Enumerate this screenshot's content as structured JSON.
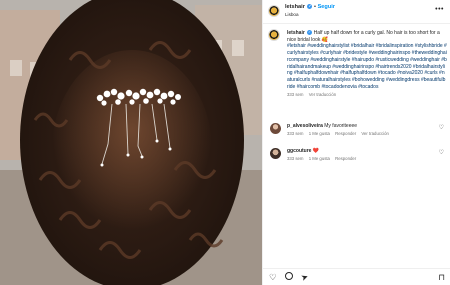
{
  "post": {
    "username": "letshair",
    "follow_label": "Seguir",
    "location": "Lisboa",
    "more_label": "•••"
  },
  "caption": {
    "username": "letshair",
    "text": "Half up half down for a curly gal. No hair is too short for a nice bridal look 🥰",
    "hashtags": "#letshair #weddinghairstylist #bridalhair #bridalinspiration #stylishbride #curlyhairstyles #curlyhair #bridestyle #weddinghairinspo #theweddinghaircompany #weddinghairstyle #hairupdo #rusticwedding #weddinghair #bridalhairandmakeup #weddinghairinspo #hairtrends2020 #bridalhairstyling #halfuphalfdownhair #halfuphalfdown #tocado #noiva2020 #curls #naturalcurls #naturalhairstyles #bohowedding #weddingdress #beautifulbride #haircomb #tocadodenovia #tocados",
    "time": "333 sem",
    "translate": "Ver traducción"
  },
  "comments": [
    {
      "username": "p_alvesoliveira",
      "text": "My favoriteeee",
      "time": "333 sem",
      "likes": "1 Me gusta",
      "reply": "Responder",
      "translate": "Ver traducción"
    },
    {
      "username": "ggcouture",
      "text": "❤️",
      "time": "333 sem",
      "likes": "1 Me gusta",
      "reply": "Responder"
    }
  ],
  "icons": {
    "heart": "♡",
    "comment": "",
    "share": "➤",
    "save": "⊓"
  },
  "colors": {
    "link": "#00376b",
    "follow": "#0095f6",
    "verified": "#3897f0"
  }
}
